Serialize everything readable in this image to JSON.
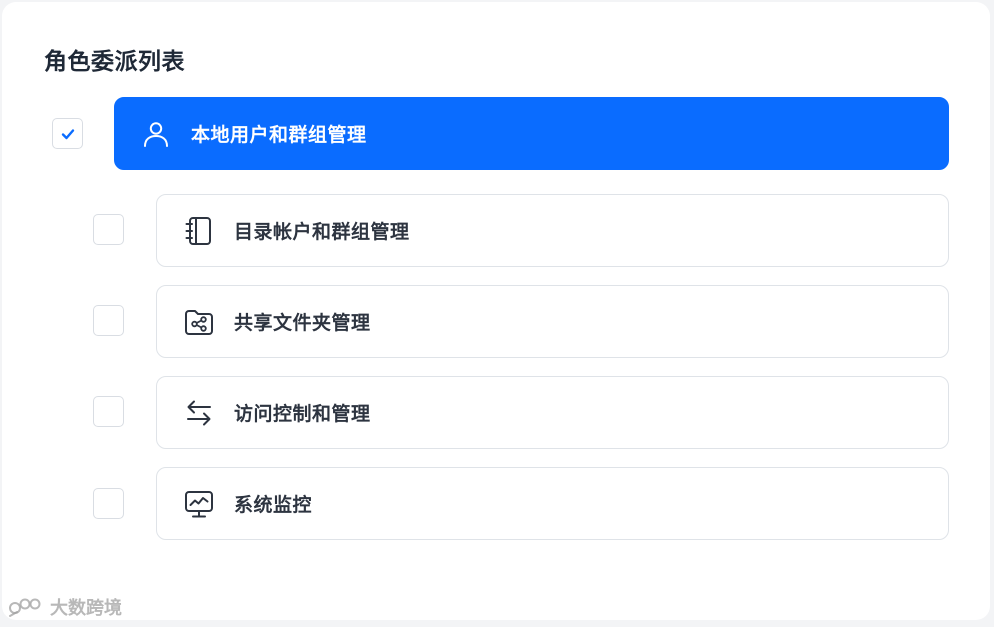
{
  "panel": {
    "title": "角色委派列表"
  },
  "items": [
    {
      "label": "本地用户和群组管理",
      "checked": true,
      "active": true,
      "icon": "user-icon"
    },
    {
      "label": "目录帐户和群组管理",
      "checked": false,
      "active": false,
      "icon": "notebook-icon"
    },
    {
      "label": "共享文件夹管理",
      "checked": false,
      "active": false,
      "icon": "shared-folder-icon"
    },
    {
      "label": "访问控制和管理",
      "checked": false,
      "active": false,
      "icon": "arrows-exchange-icon"
    },
    {
      "label": "系统监控",
      "checked": false,
      "active": false,
      "icon": "monitor-chart-icon"
    }
  ],
  "colors": {
    "accent": "#0a6cff",
    "text": "#2d3440",
    "border": "#dfe3e8"
  },
  "watermark": {
    "text": "大数跨境"
  }
}
